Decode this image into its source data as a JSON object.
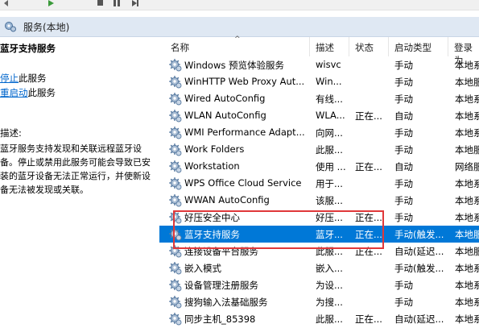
{
  "scope": {
    "title": "服务(本地)"
  },
  "left_panel": {
    "service_name": "蓝牙支持服务",
    "stop_link": "停止",
    "stop_suffix": "此服务",
    "restart_link": "重启动",
    "restart_suffix": "此服务",
    "description_label": "描述:",
    "description": "蓝牙服务支持发现和关联远程蓝牙设备。停止或禁用此服务可能会导致已安装的蓝牙设备无法正常运行，并使新设备无法被发现或关联。"
  },
  "table": {
    "headers": {
      "name": "名称",
      "desc": "描述",
      "status": "状态",
      "startup": "启动类型",
      "logon": "登录为"
    },
    "rows": [
      {
        "name": "Windows 预览体验服务",
        "desc": "wisvc",
        "status": "",
        "startup": "手动",
        "logon": "本地系"
      },
      {
        "name": "WinHTTP Web Proxy Aut...",
        "desc": "Win...",
        "status": "",
        "startup": "手动",
        "logon": "本地服"
      },
      {
        "name": "Wired AutoConfig",
        "desc": "有线...",
        "status": "",
        "startup": "手动",
        "logon": "本地系"
      },
      {
        "name": "WLAN AutoConfig",
        "desc": "WLA...",
        "status": "正在...",
        "startup": "自动",
        "logon": "本地系"
      },
      {
        "name": "WMI Performance Adapt...",
        "desc": "向网...",
        "status": "",
        "startup": "手动",
        "logon": "本地系"
      },
      {
        "name": "Work Folders",
        "desc": "此服...",
        "status": "",
        "startup": "手动",
        "logon": "本地服"
      },
      {
        "name": "Workstation",
        "desc": "使用 ...",
        "status": "正在...",
        "startup": "自动",
        "logon": "网络服"
      },
      {
        "name": "WPS Office Cloud Service",
        "desc": "用于...",
        "status": "",
        "startup": "手动",
        "logon": "本地系"
      },
      {
        "name": "WWAN AutoConfig",
        "desc": "该服...",
        "status": "",
        "startup": "手动",
        "logon": "本地系"
      },
      {
        "name": "好压安全中心",
        "desc": "好压...",
        "status": "正在...",
        "startup": "手动",
        "logon": "本地系"
      },
      {
        "name": "蓝牙支持服务",
        "desc": "蓝牙...",
        "status": "正在...",
        "startup": "手动(触发...",
        "logon": "本地服"
      },
      {
        "name": "连接设备平台服务",
        "desc": "此服...",
        "status": "正在...",
        "startup": "自动(延迟...",
        "logon": "本地服"
      },
      {
        "name": "嵌入模式",
        "desc": "嵌入...",
        "status": "",
        "startup": "手动(触发...",
        "logon": "本地系"
      },
      {
        "name": "设备管理注册服务",
        "desc": "为设...",
        "status": "",
        "startup": "手动",
        "logon": "本地系"
      },
      {
        "name": "搜狗输入法基础服务",
        "desc": "为搜...",
        "status": "",
        "startup": "手动",
        "logon": "本地系"
      },
      {
        "name": "同步主机_85398",
        "desc": "此服...",
        "status": "正在...",
        "startup": "自动(延迟...",
        "logon": "本地系"
      }
    ],
    "selected_index": 10
  },
  "colors": {
    "selection": "#0078d7",
    "highlight_box": "#e0383a",
    "link": "#0066cc"
  },
  "icons": {
    "row_icon": "gear-icon",
    "scope_icon": "services-icon"
  }
}
